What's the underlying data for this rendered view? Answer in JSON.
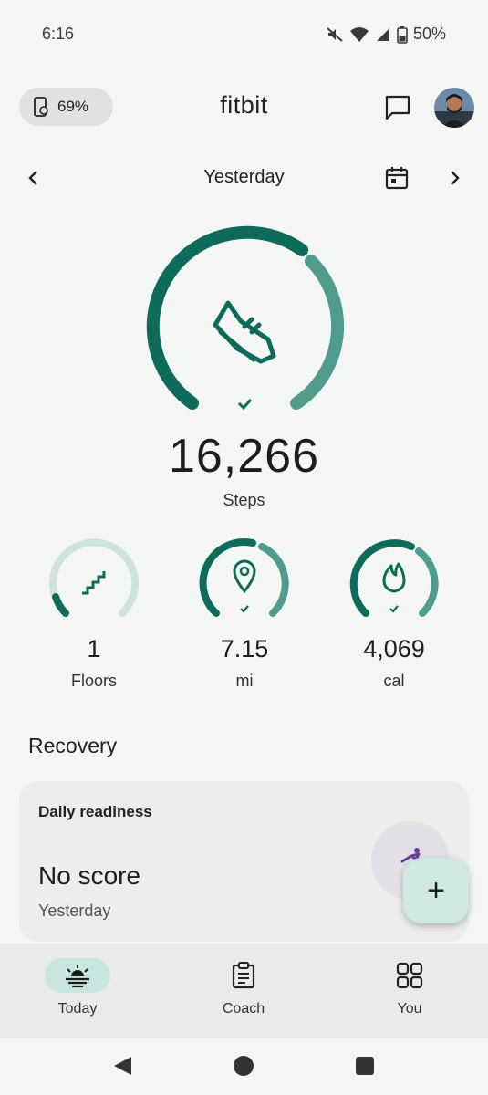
{
  "status": {
    "time": "6:16",
    "battery": "50%"
  },
  "header": {
    "device_battery": "69%",
    "app_title": "fitbit"
  },
  "date_nav": {
    "label": "Yesterday"
  },
  "steps": {
    "value": "16,266",
    "label": "Steps",
    "progress": 1.0
  },
  "metrics": [
    {
      "value": "1",
      "label": "Floors",
      "progress": 0.1,
      "icon": "stairs-icon"
    },
    {
      "value": "7.15",
      "label": "mi",
      "progress": 1.0,
      "icon": "location-pin-icon"
    },
    {
      "value": "4,069",
      "label": "cal",
      "progress": 1.0,
      "icon": "flame-icon"
    }
  ],
  "recovery": {
    "section_title": "Recovery",
    "card_title": "Daily readiness",
    "score": "No score",
    "subtitle": "Yesterday"
  },
  "fab": {
    "label": "+"
  },
  "bottom_nav": [
    {
      "label": "Today",
      "icon": "sunrise-icon",
      "active": true
    },
    {
      "label": "Coach",
      "icon": "clipboard-icon",
      "active": false
    },
    {
      "label": "You",
      "icon": "grid-icon",
      "active": false
    }
  ],
  "colors": {
    "accent_dark": "#0e6b5c",
    "accent_light": "#4f9c8e",
    "track": "#cfe3de"
  }
}
